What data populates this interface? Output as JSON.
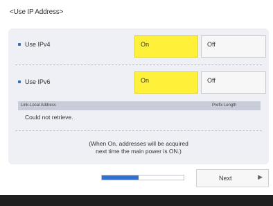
{
  "header": {
    "title": "<Use IP Address>"
  },
  "ipv4": {
    "label": "Use IPv4",
    "on_label": "On",
    "off_label": "Off",
    "selected": "On"
  },
  "ipv6": {
    "label": "Use IPv6",
    "on_label": "On",
    "off_label": "Off",
    "selected": "On"
  },
  "address_table": {
    "columns": [
      "Link-Local Address",
      "Prefix Length"
    ],
    "value": "Could not retrieve."
  },
  "note": {
    "line1": "(When On, addresses will be acquired",
    "line2": "next time the main power is ON.)"
  },
  "footer": {
    "progress": 0.45,
    "next_label": "Next",
    "next_arrow": "▶"
  },
  "colors": {
    "selected": "#fff03a",
    "accent": "#2f6fd0",
    "panel": "#eef0f5",
    "bottom_bar": "#1f1f1f"
  }
}
